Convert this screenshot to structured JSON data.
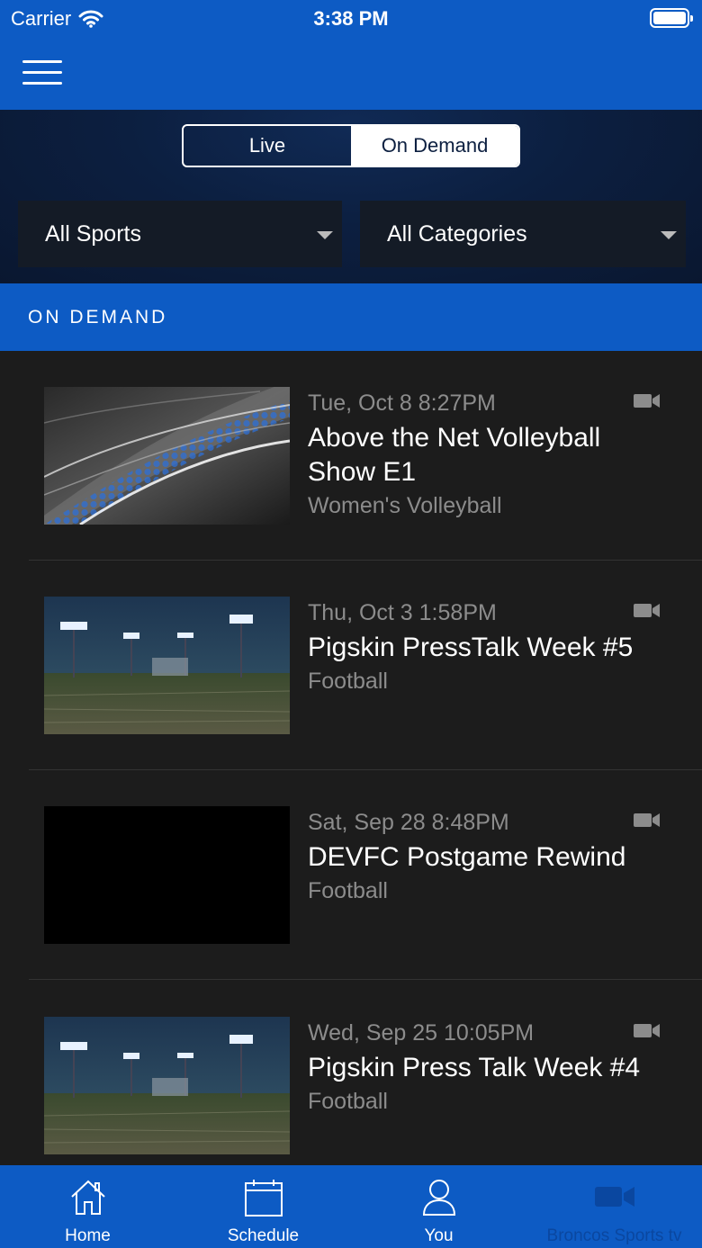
{
  "status_bar": {
    "carrier": "Carrier",
    "time": "3:38 PM"
  },
  "segment": {
    "live_label": "Live",
    "on_demand_label": "On Demand",
    "selected": "On Demand"
  },
  "filters": {
    "sports": "All Sports",
    "categories": "All Categories"
  },
  "section_title": "ON DEMAND",
  "items": [
    {
      "date": "Tue, Oct 8 8:27PM",
      "title": "Above the Net Volleyball Show E1",
      "category": "Women's Volleyball",
      "thumb": "abstract-hex"
    },
    {
      "date": "Thu, Oct 3 1:58PM",
      "title": "Pigskin PressTalk Week #5",
      "category": "Football",
      "thumb": "stadium"
    },
    {
      "date": "Sat, Sep 28 8:48PM",
      "title": "DEVFC Postgame Rewind",
      "category": "Football",
      "thumb": "black"
    },
    {
      "date": "Wed, Sep 25 10:05PM",
      "title": "Pigskin Press Talk Week #4",
      "category": "Football",
      "thumb": "stadium"
    }
  ],
  "tabs": [
    {
      "label": "Home",
      "icon": "home-icon"
    },
    {
      "label": "Schedule",
      "icon": "calendar-icon"
    },
    {
      "label": "You",
      "icon": "user-icon"
    },
    {
      "label": "Broncos Sports tv",
      "icon": "video-camera-icon"
    }
  ],
  "colors": {
    "primary": "#0d5bc4",
    "header_dark": "#0c1f40",
    "list_bg": "#1c1c1c",
    "muted_text": "#8c8c8c"
  }
}
